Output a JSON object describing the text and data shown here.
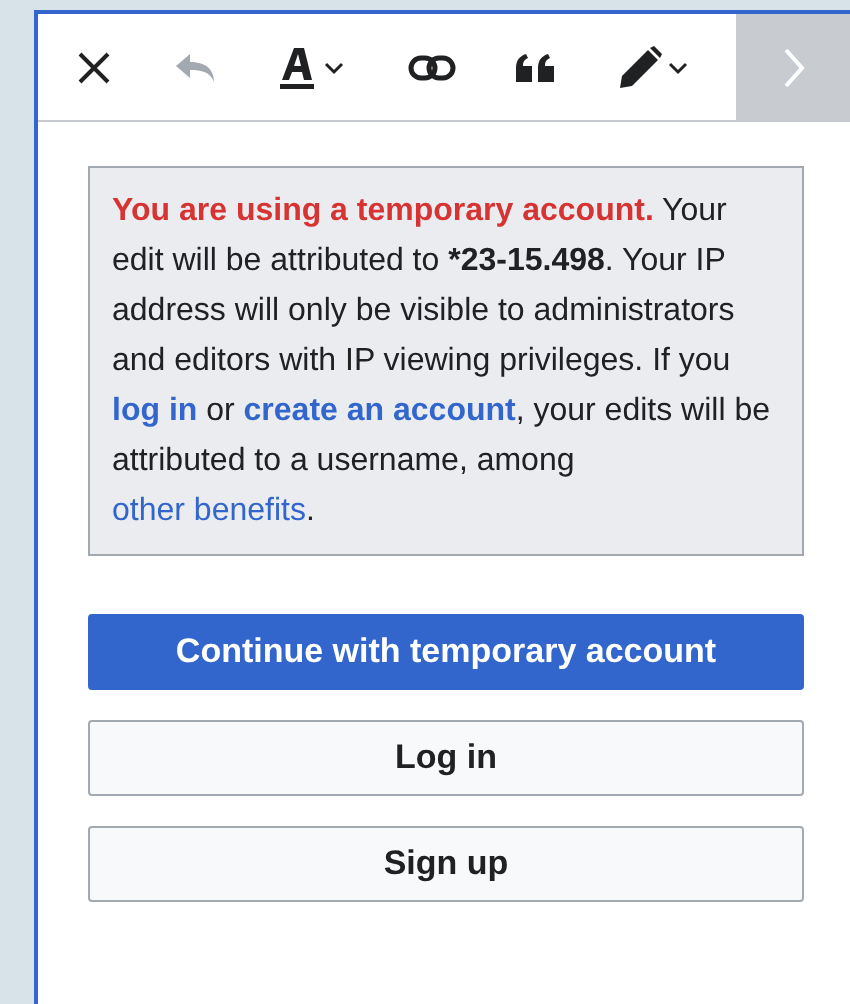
{
  "toolbar": {
    "tools": [
      {
        "kind": "close",
        "disabled": false
      },
      {
        "kind": "undo",
        "disabled": true
      },
      {
        "kind": "text-style",
        "disabled": false
      },
      {
        "kind": "link",
        "disabled": false
      },
      {
        "kind": "quote",
        "disabled": false
      },
      {
        "kind": "pen",
        "disabled": false
      }
    ],
    "next": {
      "disabled": true
    }
  },
  "notice": {
    "segments": [
      {
        "kind": "warning",
        "text": "You are using a temporary account."
      },
      {
        "kind": "text",
        "text": " Your edit will be attributed to "
      },
      {
        "kind": "bold",
        "text": "*23-15.498"
      },
      {
        "kind": "text",
        "text": ". Your IP address will only be visible to administrators and editors with IP viewing privileges. If you "
      },
      {
        "kind": "strong-link",
        "text": "log in"
      },
      {
        "kind": "text",
        "text": " or "
      },
      {
        "kind": "strong-link",
        "text": "create an account"
      },
      {
        "kind": "text",
        "text": ", your edits will be attributed to a username, among "
      },
      {
        "kind": "link",
        "text": "other benefits"
      },
      {
        "kind": "text",
        "text": "."
      }
    ]
  },
  "buttons": [
    {
      "label": "Continue with temporary account",
      "kind": "primary"
    },
    {
      "label": "Log in",
      "kind": "secondary"
    },
    {
      "label": "Sign up",
      "kind": "secondary"
    }
  ]
}
